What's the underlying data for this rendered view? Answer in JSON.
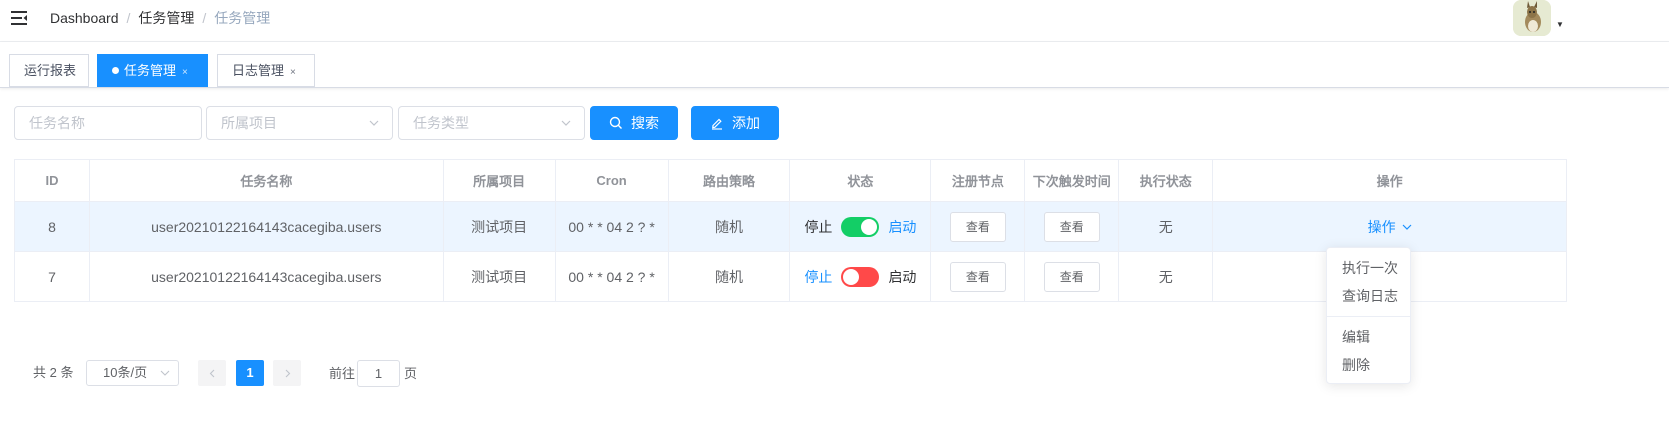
{
  "breadcrumb": [
    "Dashboard",
    "任务管理",
    "任务管理"
  ],
  "breadcrumb_sep": "/",
  "tags": [
    {
      "label": "运行报表",
      "active": false
    },
    {
      "label": "任务管理",
      "active": true
    },
    {
      "label": "日志管理",
      "active": false
    }
  ],
  "tag_close": "×",
  "filters": {
    "task_name_placeholder": "任务名称",
    "project_placeholder": "所属项目",
    "type_placeholder": "任务类型",
    "search_label": "搜索",
    "add_label": "添加"
  },
  "table": {
    "headers": [
      "ID",
      "任务名称",
      "所属项目",
      "Cron",
      "路由策略",
      "状态",
      "注册节点",
      "下次触发时间",
      "执行状态",
      "操作"
    ],
    "rows": [
      {
        "id": "8",
        "name": "user20210122164143cacegiba.users",
        "project": "测试项目",
        "cron": "00 * * 04 2 ? *",
        "route": "随机",
        "status_off": "停止",
        "status_on": "启动",
        "enabled": true,
        "nodes": "查看",
        "next": "查看",
        "exec": "无",
        "op": "操作"
      },
      {
        "id": "7",
        "name": "user20210122164143cacegiba.users",
        "project": "测试项目",
        "cron": "00 * * 04 2 ? *",
        "route": "随机",
        "status_off": "停止",
        "status_on": "启动",
        "enabled": false,
        "nodes": "查看",
        "next": "查看",
        "exec": "无"
      }
    ]
  },
  "dropdown": {
    "items": [
      "执行一次",
      "查询日志",
      "编辑",
      "删除"
    ]
  },
  "pagination": {
    "total_text": "共 2 条",
    "page_size": "10条/页",
    "current_page": "1",
    "goto_label": "前往",
    "goto_value": "1",
    "goto_suffix": "页"
  },
  "colors": {
    "primary": "#1890ff",
    "switch_on": "#13ce66",
    "switch_off": "#ff4949"
  },
  "icons": [
    "hamburger-icon",
    "avatar",
    "search-icon",
    "edit-icon",
    "chevron-down-icon",
    "chevron-left-icon",
    "chevron-right-icon",
    "close-icon"
  ]
}
